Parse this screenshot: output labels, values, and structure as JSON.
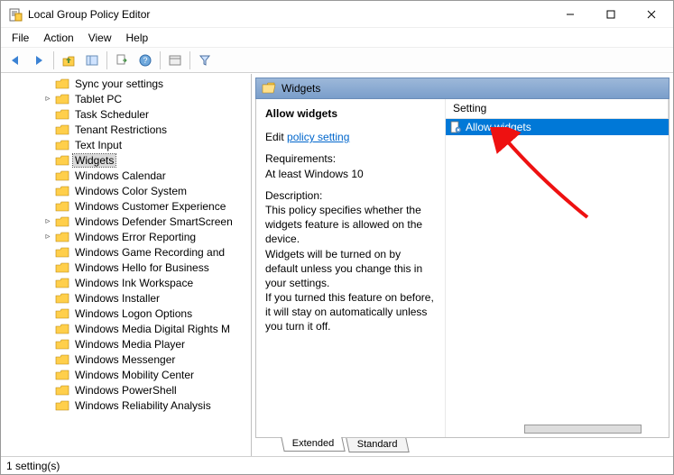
{
  "window": {
    "title": "Local Group Policy Editor"
  },
  "menus": [
    "File",
    "Action",
    "View",
    "Help"
  ],
  "tree": {
    "items": [
      {
        "label": "Sync your settings",
        "twisty": ""
      },
      {
        "label": "Tablet PC",
        "twisty": ">"
      },
      {
        "label": "Task Scheduler",
        "twisty": ""
      },
      {
        "label": "Tenant Restrictions",
        "twisty": ""
      },
      {
        "label": "Text Input",
        "twisty": ""
      },
      {
        "label": "Widgets",
        "twisty": "",
        "selected": true
      },
      {
        "label": "Windows Calendar",
        "twisty": ""
      },
      {
        "label": "Windows Color System",
        "twisty": ""
      },
      {
        "label": "Windows Customer Experience",
        "twisty": ""
      },
      {
        "label": "Windows Defender SmartScreen",
        "twisty": ">"
      },
      {
        "label": "Windows Error Reporting",
        "twisty": ">"
      },
      {
        "label": "Windows Game Recording and",
        "twisty": ""
      },
      {
        "label": "Windows Hello for Business",
        "twisty": ""
      },
      {
        "label": "Windows Ink Workspace",
        "twisty": ""
      },
      {
        "label": "Windows Installer",
        "twisty": ""
      },
      {
        "label": "Windows Logon Options",
        "twisty": ""
      },
      {
        "label": "Windows Media Digital Rights M",
        "twisty": ""
      },
      {
        "label": "Windows Media Player",
        "twisty": ""
      },
      {
        "label": "Windows Messenger",
        "twisty": ""
      },
      {
        "label": "Windows Mobility Center",
        "twisty": ""
      },
      {
        "label": "Windows PowerShell",
        "twisty": ""
      },
      {
        "label": "Windows Reliability Analysis",
        "twisty": ""
      }
    ]
  },
  "detail": {
    "header": "Widgets",
    "policy_title": "Allow widgets",
    "edit_prefix": "Edit ",
    "edit_link": "policy setting ",
    "req_label": "Requirements:",
    "req_text": "At least Windows 10",
    "desc_label": "Description:",
    "desc_p1": "This policy specifies whether the widgets feature is allowed on the device.",
    "desc_p2": "Widgets will be turned on by default unless you change this in your settings.",
    "desc_p3": "If you turned this feature on before, it will stay on automatically unless you turn it off.",
    "columns": [
      "Setting"
    ],
    "rows": [
      {
        "label": "Allow widgets",
        "selected": true
      }
    ],
    "tabs": {
      "extended": "Extended",
      "standard": "Standard"
    }
  },
  "status": "1 setting(s)"
}
